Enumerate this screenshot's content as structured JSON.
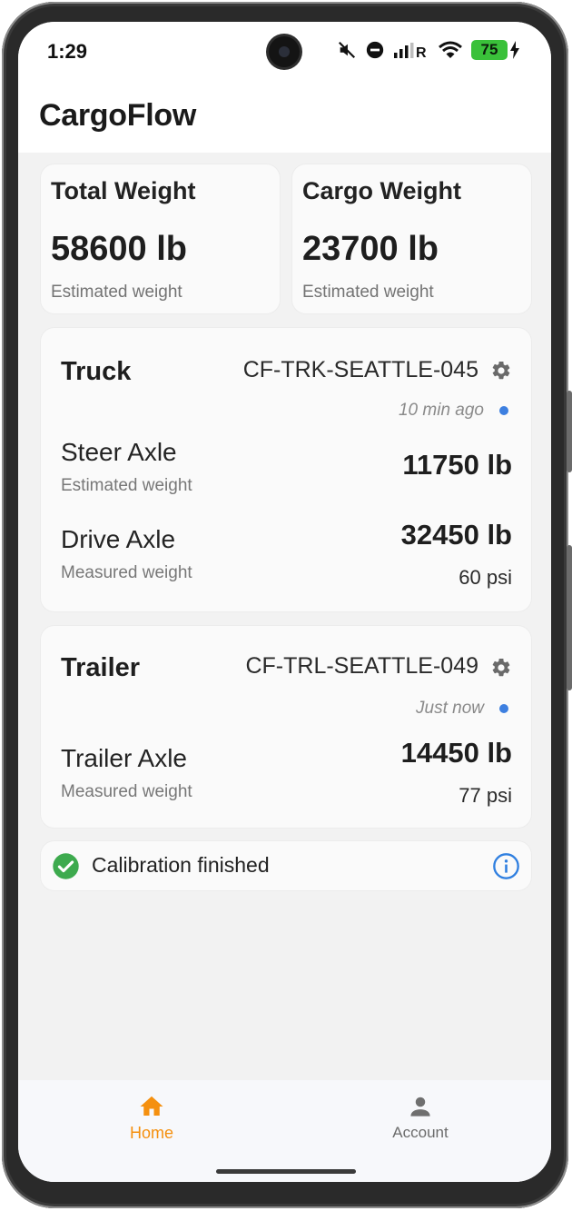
{
  "status_bar": {
    "time": "1:29",
    "battery": "75"
  },
  "app": {
    "title": "CargoFlow"
  },
  "summary": [
    {
      "title": "Total Weight",
      "value": "58600 lb",
      "subtitle": "Estimated weight"
    },
    {
      "title": "Cargo Weight",
      "value": "23700 lb",
      "subtitle": "Estimated weight"
    }
  ],
  "truck": {
    "name": "Truck",
    "id": "CF-TRK-SEATTLE-045",
    "updated": "10 min ago",
    "axles": [
      {
        "name": "Steer Axle",
        "subtitle": "Estimated weight",
        "weight": "11750 lb"
      },
      {
        "name": "Drive Axle",
        "subtitle": "Measured weight",
        "weight": "32450 lb",
        "pressure": "60 psi"
      }
    ]
  },
  "trailer": {
    "name": "Trailer",
    "id": "CF-TRL-SEATTLE-049",
    "updated": "Just now",
    "axles": [
      {
        "name": "Trailer Axle",
        "subtitle": "Measured weight",
        "weight": "14450 lb",
        "pressure": "77 psi"
      }
    ]
  },
  "calibration": {
    "message": "Calibration finished"
  },
  "nav": {
    "items": [
      {
        "label": "Home",
        "active": true
      },
      {
        "label": "Account",
        "active": false
      }
    ]
  },
  "colors": {
    "accent": "#f5900f",
    "status_dot": "#3d7fe0",
    "success": "#3daa4e",
    "info": "#2f7fe0",
    "battery": "#3ac13a"
  },
  "icons": [
    "mute-icon",
    "dnd-icon",
    "signal-icon",
    "wifi-icon",
    "battery-icon",
    "gear-icon",
    "check-circle-icon",
    "info-icon",
    "home-icon",
    "account-icon"
  ]
}
